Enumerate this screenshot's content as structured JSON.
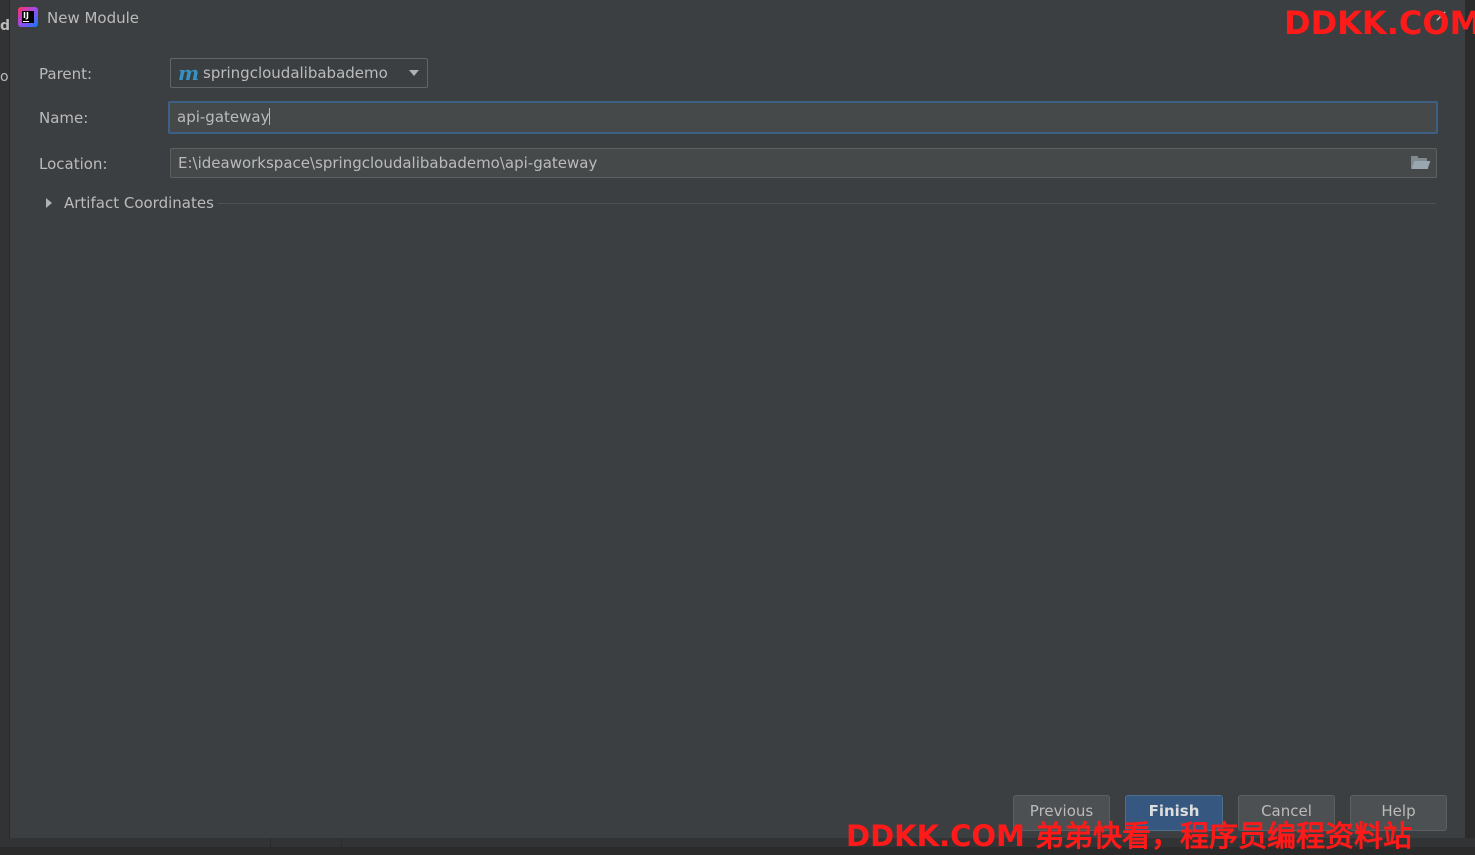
{
  "background_window": {
    "left_letters": [
      "d",
      "ol"
    ]
  },
  "dialog": {
    "title": "New Module",
    "close_glyph": "✕",
    "form": {
      "parent_label": "Parent:",
      "parent_icon_glyph": "m",
      "parent_value": "springcloudalibabademo",
      "name_label": "Name:",
      "name_value": "api-gateway",
      "location_label": "Location:",
      "location_value": "E:\\ideaworkspace\\springcloudalibabademo\\api-gateway"
    },
    "artifact_section_label": "Artifact Coordinates",
    "buttons": {
      "previous": "Previous",
      "finish": "Finish",
      "cancel": "Cancel",
      "help": "Help"
    }
  },
  "watermarks": {
    "top": "DDKK.COM",
    "bottom": "DDKK.COM 弟弟快看，程序员编程资料站"
  },
  "colors": {
    "dialog_bg": "#3c3f41",
    "field_bg": "#45494a",
    "focus_border": "#3d6185",
    "primary_button": "#365880",
    "maven_icon": "#3592c4",
    "watermark": "#ff1a1a"
  },
  "icons": [
    "intellij-app-icon",
    "close-icon",
    "maven-icon",
    "chevron-down-icon",
    "folder-icon",
    "expand-arrow-icon"
  ]
}
